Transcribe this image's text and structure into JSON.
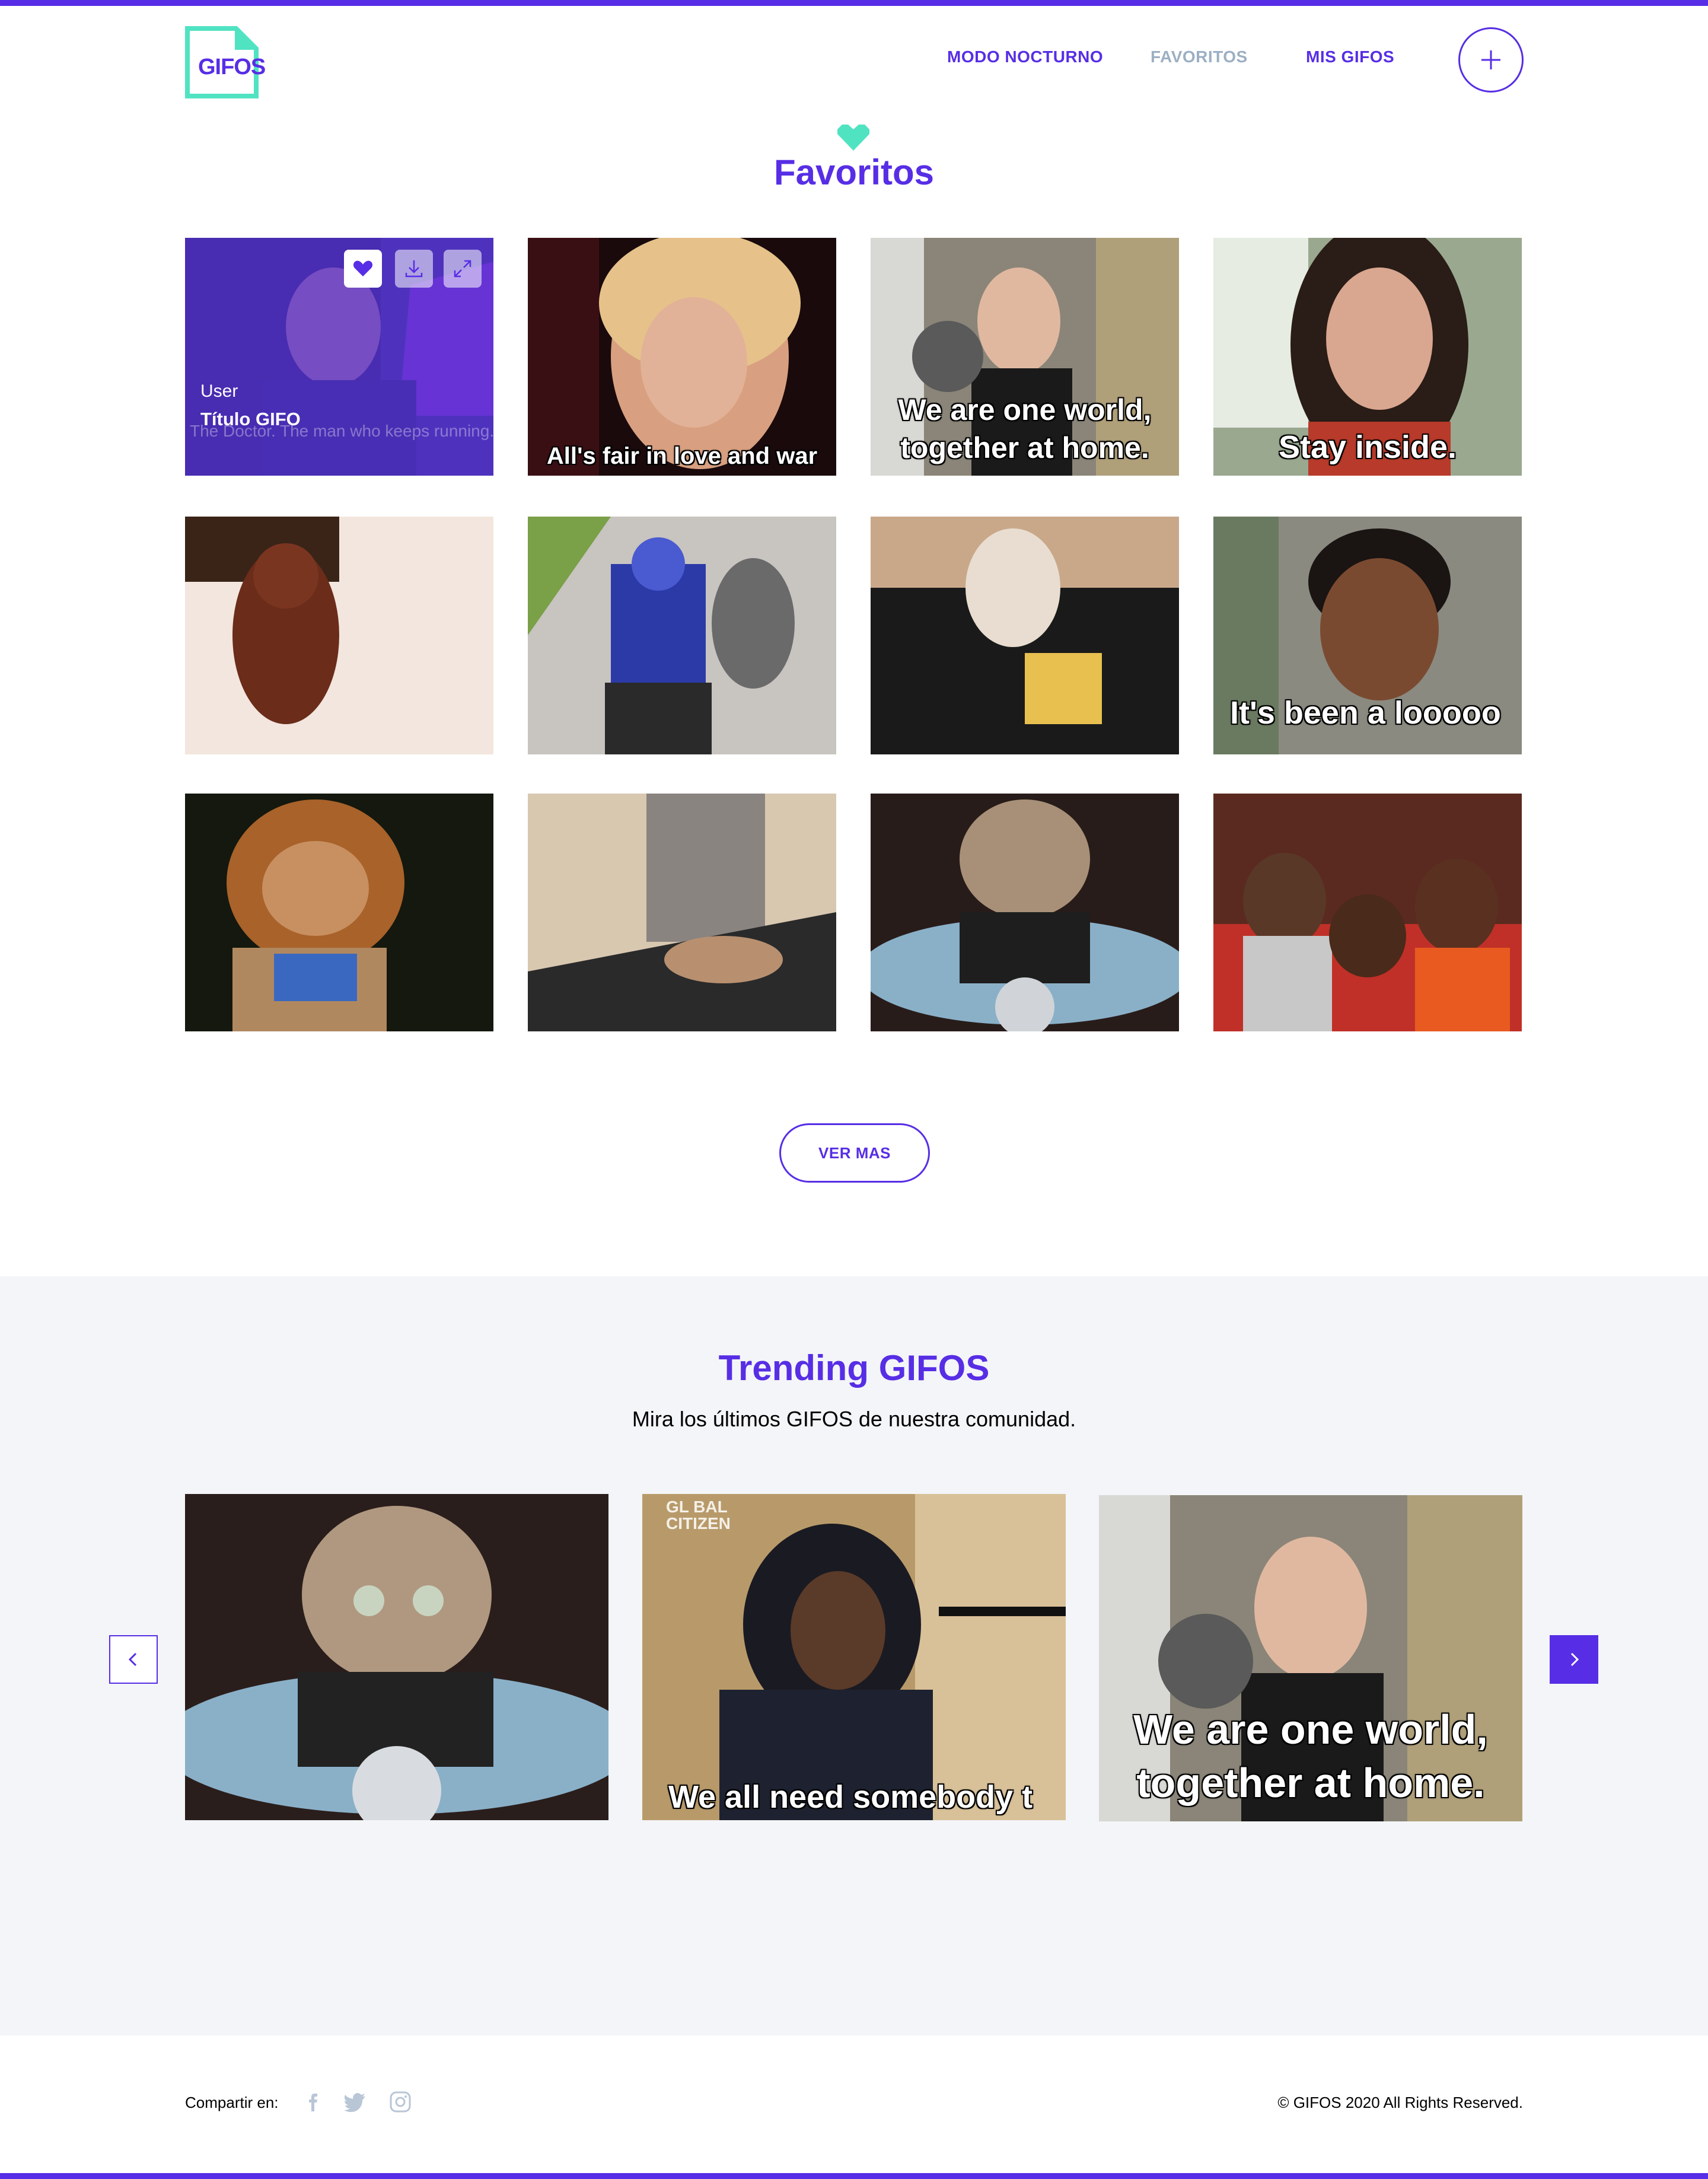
{
  "colors": {
    "brand": "#572EE5",
    "accent": "#50E3C2",
    "inactive": "#9CAFC3",
    "trending_bg": "#F3F5F8"
  },
  "header": {
    "logo_text": "GIFOS",
    "nav": {
      "night_mode": "MODO NOCTURNO",
      "favorites": "FAVORITOS",
      "my_gifs": "MIS GIFOS"
    },
    "add_button_icon": "plus-icon"
  },
  "favorites": {
    "icon": "heart-icon",
    "title": "Favoritos",
    "hover_card": {
      "user": "User",
      "title": "Título GIFO",
      "faint_caption": "The Doctor. The man who keeps running.",
      "buttons": [
        "heart-icon",
        "download-icon",
        "expand-icon"
      ]
    },
    "gifs": [
      {
        "caption": ""
      },
      {
        "caption": "All's fair in love and war"
      },
      {
        "caption_line1": "We are one world,",
        "caption_line2": "together at home."
      },
      {
        "caption": "Stay inside."
      },
      {
        "caption": ""
      },
      {
        "caption": ""
      },
      {
        "caption": ""
      },
      {
        "caption": "It's been a looooo"
      },
      {
        "caption": ""
      },
      {
        "caption": ""
      },
      {
        "caption": ""
      },
      {
        "caption": ""
      }
    ],
    "ver_mas": "VER MAS"
  },
  "trending": {
    "title": "Trending GIFOS",
    "subtitle": "Mira los últimos GIFOS de nuestra comunidad.",
    "gifs": [
      {
        "caption": ""
      },
      {
        "caption": "We all need somebody t",
        "watermark": "GL BAL CITIZEN"
      },
      {
        "caption_line1": "We are one world,",
        "caption_line2": "together at home."
      }
    ],
    "prev_icon": "chevron-left-icon",
    "next_icon": "chevron-right-icon"
  },
  "footer": {
    "share_label": "Compartir en:",
    "social": [
      "facebook-icon",
      "twitter-icon",
      "instagram-icon"
    ],
    "copyright": "© GIFOS 2020 All Rights Reserved."
  }
}
